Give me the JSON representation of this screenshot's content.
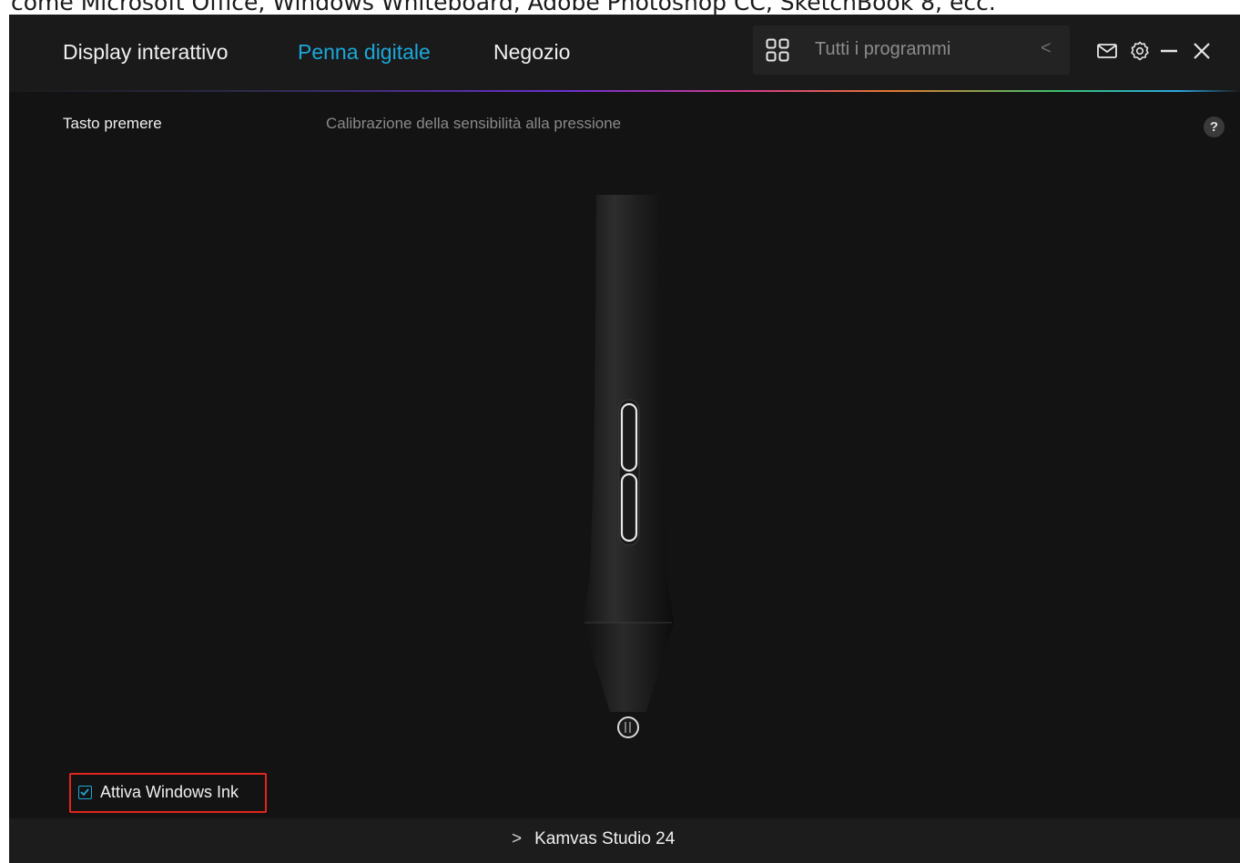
{
  "caption": "come Microsoft Office, Windows Whiteboard, Adobe Photoshop CC, SketchBook 8, ecc.",
  "nav": {
    "tabs": [
      {
        "label": "Display interattivo",
        "active": false
      },
      {
        "label": "Penna digitale",
        "active": true
      },
      {
        "label": "Negozio",
        "active": false
      }
    ]
  },
  "search": {
    "placeholder": "Tutti i programmi"
  },
  "section": {
    "left_label": "Tasto premere",
    "center_label": "Calibrazione della sensibilità alla pressione",
    "help_label": "?"
  },
  "windows_ink": {
    "label": "Attiva Windows Ink",
    "checked": true
  },
  "device": {
    "name": "Kamvas Studio 24"
  },
  "colors": {
    "accent": "#1ba8d9",
    "highlight_border": "#e0261f",
    "background": "#131313"
  },
  "icons": [
    "grid-icon",
    "chevron-left-icon",
    "mail-icon",
    "gear-icon",
    "minimize-icon",
    "close-icon",
    "help-icon",
    "checkbox-checked-icon",
    "chevron-right-icon"
  ]
}
